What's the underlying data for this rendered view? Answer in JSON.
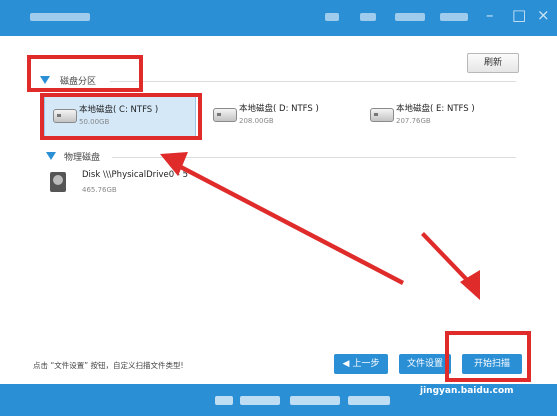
{
  "toolbar": {
    "refresh_label": "刷新"
  },
  "sections": {
    "partitions_label": "磁盘分区",
    "physical_label": "物理磁盘"
  },
  "drives": [
    {
      "name": "本地磁盘( C: NTFS )",
      "size": "50.00GB",
      "selected": true
    },
    {
      "name": "本地磁盘( D: NTFS )",
      "size": "208.00GB",
      "selected": false
    },
    {
      "name": "本地磁盘( E: NTFS )",
      "size": "207.76GB",
      "selected": false
    }
  ],
  "physical_disk": {
    "name": "Disk \\\\\\PhysicalDrive0 - 5",
    "size": "465.76GB"
  },
  "footer": {
    "hint": "点击 “文件设置” 按钮，自定义扫描文件类型!",
    "back_label": "上一步",
    "file_settings_label": "文件设置",
    "start_scan_label": "开始扫描"
  },
  "watermark": {
    "text": "jingyan.baidu.com"
  },
  "colors": {
    "accent": "#2b8fd6",
    "annotation": "#e02b2b",
    "selected_bg": "#d4e8f8"
  }
}
